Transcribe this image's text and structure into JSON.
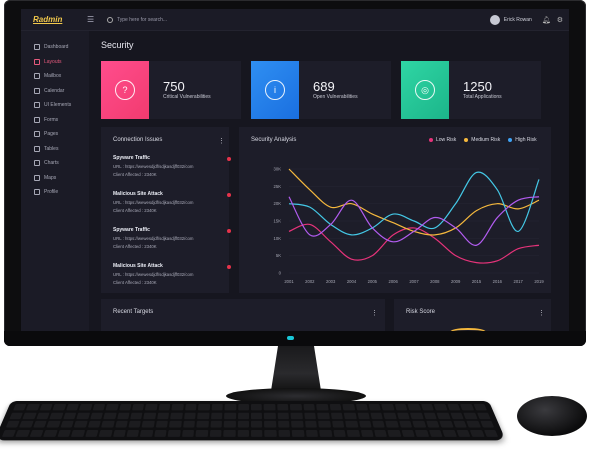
{
  "app": {
    "brand": "Radmin"
  },
  "header": {
    "search_placeholder": "Type here for search...",
    "user_name": "Erick Rowan"
  },
  "sidebar": {
    "items": [
      {
        "label": "Dashboard",
        "active": false
      },
      {
        "label": "Layouts",
        "active": true
      },
      {
        "label": "Mailbox",
        "active": false
      },
      {
        "label": "Calendar",
        "active": false
      },
      {
        "label": "UI Elements",
        "active": false
      },
      {
        "label": "Forms",
        "active": false
      },
      {
        "label": "Pages",
        "active": false
      },
      {
        "label": "Tables",
        "active": false
      },
      {
        "label": "Charts",
        "active": false
      },
      {
        "label": "Maps",
        "active": false
      },
      {
        "label": "Profile",
        "active": false
      }
    ]
  },
  "page": {
    "title": "Security"
  },
  "stats": [
    {
      "value": "750",
      "label": "Critical Vulnerabilities",
      "icon": "question-icon",
      "color_from": "#ff4d8d",
      "color_to": "#f23b6f"
    },
    {
      "value": "689",
      "label": "Open Vulnerabilities",
      "icon": "info-icon",
      "color_from": "#2f8ff2",
      "color_to": "#1a6fe0"
    },
    {
      "value": "1250",
      "label": "Total Applications",
      "icon": "lifebuoy-icon",
      "color_from": "#2fd6a4",
      "color_to": "#1cb58a"
    }
  ],
  "connection_issues": {
    "title": "Connection Issues",
    "items": [
      {
        "title": "Spyware Traffic",
        "url": "URL : https://wewesdjdf/sdjkasdjff032/com",
        "client": "Client Affected : 2340K"
      },
      {
        "title": "Malicious Site Attack",
        "url": "URL : https://wewesdjdf/sdjkasdjff032/com",
        "client": "Client Affected : 2340K"
      },
      {
        "title": "Spyware Traffic",
        "url": "URL : https://wewesdjdf/sdjkasdjff032/com",
        "client": "Client Affected : 2340K"
      },
      {
        "title": "Malicious Site Attack",
        "url": "URL : https://wewesdjdf/sdjkasdjff032/com",
        "client": "Client Affected : 2340K"
      }
    ]
  },
  "analysis": {
    "title": "Security Analysis",
    "legend": [
      {
        "name": "Low Risk",
        "color": "#e6337a"
      },
      {
        "name": "Medium Risk",
        "color": "#f5b83d"
      },
      {
        "name": "High Risk",
        "color": "#3fa3f5"
      }
    ]
  },
  "chart_data": {
    "type": "line",
    "x": [
      "2001",
      "2002",
      "2003",
      "2004",
      "2005",
      "2006",
      "2007",
      "2008",
      "2009",
      "2015",
      "2016",
      "2017",
      "2019"
    ],
    "yticks": [
      "30K",
      "25K",
      "20K",
      "15K",
      "10K",
      "5K",
      "0"
    ],
    "ylim": [
      0,
      30000
    ],
    "series": [
      {
        "name": "Low Risk",
        "color": "#e6337a",
        "values": [
          12000,
          14000,
          9000,
          4000,
          5000,
          11000,
          13000,
          10000,
          5000,
          3000,
          3500,
          7000,
          8000
        ]
      },
      {
        "name": "Medium Risk",
        "color": "#f5b83d",
        "values": [
          30000,
          24000,
          19000,
          20000,
          17000,
          14500,
          12000,
          11000,
          13000,
          18000,
          20000,
          18500,
          21000
        ]
      },
      {
        "name": "High Risk",
        "color": "#44c8e6",
        "values": [
          20000,
          19000,
          14000,
          11000,
          13000,
          17000,
          15000,
          13000,
          20000,
          29000,
          24000,
          12000,
          27000
        ]
      },
      {
        "name": "Extra",
        "color": "#b25cf0",
        "values": [
          22000,
          11000,
          14000,
          21000,
          13000,
          9000,
          12000,
          16000,
          13000,
          8000,
          16000,
          21000,
          22000
        ]
      }
    ]
  },
  "bottom": {
    "recent_targets": "Recent Targets",
    "risk_score": "Risk Score"
  },
  "colors": {
    "accent": "#e65a7d",
    "background": "#16161f",
    "panel": "#1d1d29"
  }
}
